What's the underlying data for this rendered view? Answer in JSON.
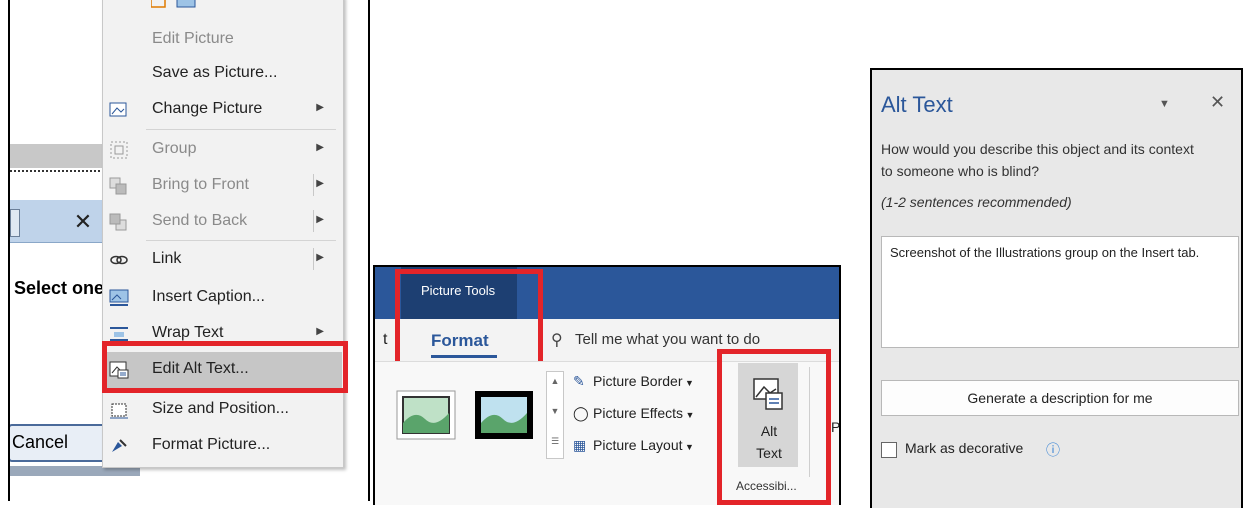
{
  "context_menu": {
    "items": [
      {
        "label": "Edit Picture",
        "disabled": true,
        "icon": "none",
        "arrow": false
      },
      {
        "label": "Save as Picture...",
        "disabled": false,
        "icon": "none",
        "arrow": false
      },
      {
        "label": "Change Picture",
        "disabled": false,
        "icon": "change-picture-icon",
        "arrow": true
      },
      {
        "label": "Group",
        "disabled": true,
        "icon": "group-icon",
        "arrow": true
      },
      {
        "label": "Bring to Front",
        "disabled": true,
        "icon": "bring-to-front-icon",
        "arrow": true
      },
      {
        "label": "Send to Back",
        "disabled": true,
        "icon": "send-to-back-icon",
        "arrow": true
      },
      {
        "label": "Link",
        "disabled": false,
        "icon": "link-icon",
        "arrow": true
      },
      {
        "label": "Insert Caption...",
        "disabled": false,
        "icon": "insert-caption-icon",
        "arrow": false
      },
      {
        "label": "Wrap Text",
        "disabled": false,
        "icon": "wrap-text-icon",
        "arrow": true
      },
      {
        "label": "Edit Alt Text...",
        "disabled": false,
        "icon": "edit-alt-text-icon",
        "arrow": false,
        "highlighted": true
      },
      {
        "label": "Size and Position...",
        "disabled": false,
        "icon": "size-position-icon",
        "arrow": false
      },
      {
        "label": "Format Picture...",
        "disabled": false,
        "icon": "format-picture-icon",
        "arrow": false
      }
    ]
  },
  "background_dialog": {
    "text": "Select one",
    "cancel_label": "Cancel",
    "close_glyph": "✕"
  },
  "ribbon": {
    "contextual_tab_group": "Picture Tools",
    "partial_tab": "t",
    "active_tab": "Format",
    "tell_me": "Tell me what you want to do",
    "buttons": {
      "picture_border": "Picture Border",
      "picture_effects": "Picture Effects",
      "picture_layout": "Picture Layout",
      "alt_text_line1": "Alt",
      "alt_text_line2": "Text",
      "position": "Positi"
    },
    "group_label": "Accessibi..."
  },
  "alt_text_pane": {
    "title": "Alt Text",
    "question": "How would you describe this object and its context to someone who is blind?",
    "hint": "(1-2 sentences recommended)",
    "description": "Screenshot of the Illustrations group on the Insert tab.",
    "generate_button": "Generate a description for me",
    "mark_decorative": "Mark as decorative",
    "mark_decorative_checked": false
  },
  "colors": {
    "accent": "#2b579a",
    "highlight_box": "#e32429",
    "menu_bg": "#f2f2f2",
    "pane_bg": "#e8e8e8"
  }
}
